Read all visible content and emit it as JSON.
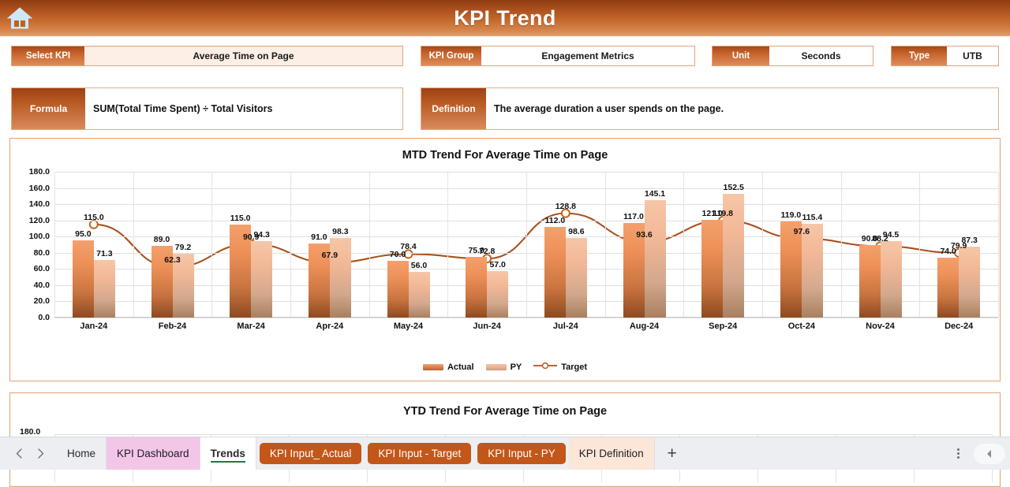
{
  "header": {
    "title": "KPI Trend",
    "home_icon": "home-icon"
  },
  "selectors": [
    {
      "label": "Select KPI",
      "value": "Average Time on Page"
    },
    {
      "label": "KPI Group",
      "value": "Engagement Metrics"
    },
    {
      "label": "Unit",
      "value": "Seconds"
    },
    {
      "label": "Type",
      "value": "UTB"
    }
  ],
  "info": {
    "formula_label": "Formula",
    "formula_value": "SUM(Total Time Spent) ÷ Total Visitors",
    "definition_label": "Definition",
    "definition_value": "The average duration a user spends on the page."
  },
  "chart_data": [
    {
      "type": "bar",
      "title": "MTD Trend For Average Time on Page",
      "xlabel": "",
      "ylabel": "",
      "ylim": [
        0,
        180
      ],
      "ytick_step": 20,
      "yticks": [
        "0.0",
        "20.0",
        "40.0",
        "60.0",
        "80.0",
        "100.0",
        "120.0",
        "140.0",
        "160.0",
        "180.0"
      ],
      "grid": true,
      "legend_position": "bottom",
      "categories": [
        "Jan-24",
        "Feb-24",
        "Mar-24",
        "Apr-24",
        "May-24",
        "Jun-24",
        "Jul-24",
        "Aug-24",
        "Sep-24",
        "Oct-24",
        "Nov-24",
        "Dec-24"
      ],
      "series": [
        {
          "name": "Actual",
          "kind": "bar",
          "color": "#e0854f",
          "values": [
            95.0,
            89.0,
            115.0,
            91.0,
            70.0,
            75.0,
            112.0,
            117.0,
            121.0,
            119.0,
            90.0,
            74.0
          ]
        },
        {
          "name": "PY",
          "kind": "bar",
          "color": "#f0bb9c",
          "values": [
            71.3,
            79.2,
            94.3,
            98.3,
            56.0,
            57.0,
            98.6,
            145.1,
            152.5,
            115.4,
            94.5,
            87.3
          ]
        },
        {
          "name": "Target",
          "kind": "line",
          "color": "#a9511f",
          "values": [
            115.0,
            62.3,
            90.9,
            67.9,
            78.4,
            72.8,
            128.8,
            93.6,
            119.8,
            97.6,
            88.2,
            79.9
          ]
        }
      ]
    },
    {
      "type": "bar",
      "title": "YTD Trend For Average Time on Page",
      "ylim": [
        0,
        180
      ],
      "yticks": [
        "180.0"
      ],
      "grid": true,
      "categories": [],
      "series": []
    }
  ],
  "legend": [
    {
      "label": "Actual",
      "marker": "swatch-dark"
    },
    {
      "label": "PY",
      "marker": "swatch-light"
    },
    {
      "label": "Target",
      "marker": "line-circle"
    }
  ],
  "tabbar": {
    "prev_icon": "chevron-left-icon",
    "next_icon": "chevron-right-icon",
    "add_label": "+",
    "overflow_icon": "vertical-dots-icon",
    "scroll_icon": "scroll-left-icon",
    "tabs": [
      {
        "label": "Home",
        "style": "plain",
        "active": false
      },
      {
        "label": "KPI Dashboard",
        "style": "pink",
        "active": false
      },
      {
        "label": "Trends",
        "style": "active",
        "active": true
      },
      {
        "label": "KPI Input_ Actual",
        "style": "orange",
        "active": false
      },
      {
        "label": "KPI Input - Target",
        "style": "orange",
        "active": false
      },
      {
        "label": "KPI Input - PY",
        "style": "orange",
        "active": false
      },
      {
        "label": "KPI Definition",
        "style": "peach",
        "active": false
      }
    ]
  }
}
